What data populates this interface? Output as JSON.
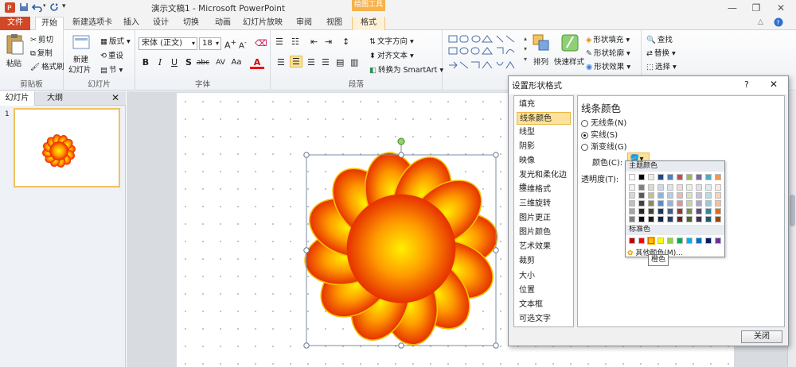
{
  "titlebar": {
    "title": "演示文稿1 - Microsoft PowerPoint",
    "context_tab_header": "绘图工具"
  },
  "tabs": [
    {
      "label": "文件"
    },
    {
      "label": "开始"
    },
    {
      "label": "新建选项卡"
    },
    {
      "label": "插入"
    },
    {
      "label": "设计"
    },
    {
      "label": "切换"
    },
    {
      "label": "动画"
    },
    {
      "label": "幻灯片放映"
    },
    {
      "label": "审阅"
    },
    {
      "label": "视图"
    },
    {
      "label": "格式"
    }
  ],
  "ribbon": {
    "clipboard": {
      "paste": "粘贴",
      "cut": "剪切",
      "copy": "复制",
      "painter": "格式刷",
      "label": "剪贴板"
    },
    "slides": {
      "new_slide": "新建",
      "new_slide2": "幻灯片",
      "layout": "版式",
      "reset": "重设",
      "section": "节",
      "label": "幻灯片"
    },
    "font": {
      "font_name": "宋体 (正文)",
      "font_size": "18",
      "label": "字体"
    },
    "paragraph": {
      "text_direction": "文字方向",
      "align_text": "对齐文本",
      "smartart": "转换为 SmartArt",
      "label": "段落"
    },
    "drawing": {
      "arrange": "排列",
      "quick_styles": "快速样式",
      "fill": "形状填充",
      "outline": "形状轮廓",
      "effects": "形状效果"
    },
    "editing": {
      "find": "查找",
      "replace": "替换",
      "select": "选择"
    }
  },
  "leftpane": {
    "tab_slides": "幻灯片",
    "tab_outline": "大纲",
    "slide_number": "1"
  },
  "dialog": {
    "title": "设置形状格式",
    "help": "?",
    "categories": [
      "填充",
      "线条颜色",
      "线型",
      "阴影",
      "映像",
      "发光和柔化边缘",
      "三维格式",
      "三维旋转",
      "图片更正",
      "图片颜色",
      "艺术效果",
      "裁剪",
      "大小",
      "位置",
      "文本框",
      "可选文字"
    ],
    "selected_category": "线条颜色",
    "panel_title": "线条颜色",
    "options": [
      "无线条(N)",
      "实线(S)",
      "渐变线(G)"
    ],
    "selected_option": "实线(S)",
    "color_label": "颜色(C):",
    "transparency_label": "透明度(T):",
    "close_button": "关闭"
  },
  "colorpicker": {
    "theme_header": "主题颜色",
    "standard_header": "标准色",
    "more_colors": "其他颜色(M)...",
    "tooltip": "橙色",
    "theme_top": [
      "#ffffff",
      "#000000",
      "#eeece1",
      "#1f497d",
      "#4f81bd",
      "#c0504d",
      "#9bbb59",
      "#8064a2",
      "#4bacc6",
      "#f79646"
    ],
    "theme_shades": [
      [
        "#f2f2f2",
        "#808080",
        "#ddd9c3",
        "#c6d9f0",
        "#dbe5f1",
        "#f2dcdb",
        "#ebf1dd",
        "#e5e0ec",
        "#dbeef3",
        "#fdeada"
      ],
      [
        "#d8d8d8",
        "#595959",
        "#c4bd97",
        "#8db3e2",
        "#b8cce4",
        "#e5b9b7",
        "#d7e3bc",
        "#ccc1d9",
        "#b7dde8",
        "#fbd5b5"
      ],
      [
        "#bfbfbf",
        "#404040",
        "#938953",
        "#548dd4",
        "#95b3d7",
        "#d99694",
        "#c3d69b",
        "#b2a2c7",
        "#92cddc",
        "#fac08f"
      ],
      [
        "#a5a5a5",
        "#262626",
        "#494429",
        "#17365d",
        "#366092",
        "#953734",
        "#76923c",
        "#5f497a",
        "#31859b",
        "#e36c09"
      ],
      [
        "#7f7f7f",
        "#0c0c0c",
        "#1d1b10",
        "#0f243e",
        "#244061",
        "#632423",
        "#4f6128",
        "#3f3151",
        "#205867",
        "#974806"
      ]
    ],
    "standard": [
      "#c00000",
      "#ff0000",
      "#ffc000",
      "#ffff00",
      "#92d050",
      "#00b050",
      "#00b0f0",
      "#0070c0",
      "#002060",
      "#7030a0"
    ],
    "selected_standard_index": 2
  }
}
